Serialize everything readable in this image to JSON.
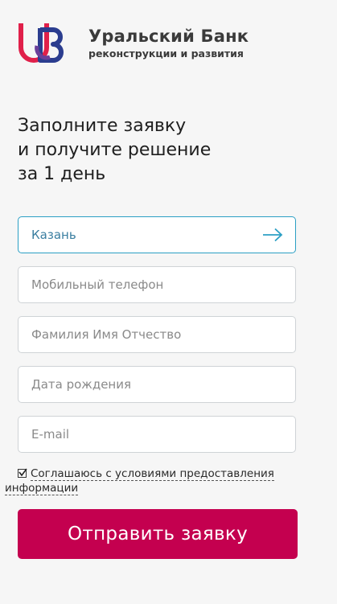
{
  "brand": {
    "name": "Уральский Банк",
    "subtitle": "реконструкции и развития",
    "colors": {
      "red": "#e0204a",
      "blue": "#2b3d8f",
      "accent": "#c4004f",
      "focus": "#2b9fc4"
    }
  },
  "heading": {
    "line1": "Заполните заявку",
    "line2": "и получите решение",
    "line3": "за 1 день"
  },
  "form": {
    "city_value": "Казань",
    "phone_placeholder": "Мобильный телефон",
    "name_placeholder": "Фамилия Имя Отчество",
    "birthdate_placeholder": "Дата рождения",
    "email_placeholder": "E-mail",
    "consent_line1": "Соглашаюсь с условиями предоставления",
    "consent_line2": "информации",
    "consent_checked": true,
    "submit_label": "Отправить заявку"
  },
  "icons": {
    "city_next": "arrow-right-icon",
    "checkbox": "check-icon"
  }
}
